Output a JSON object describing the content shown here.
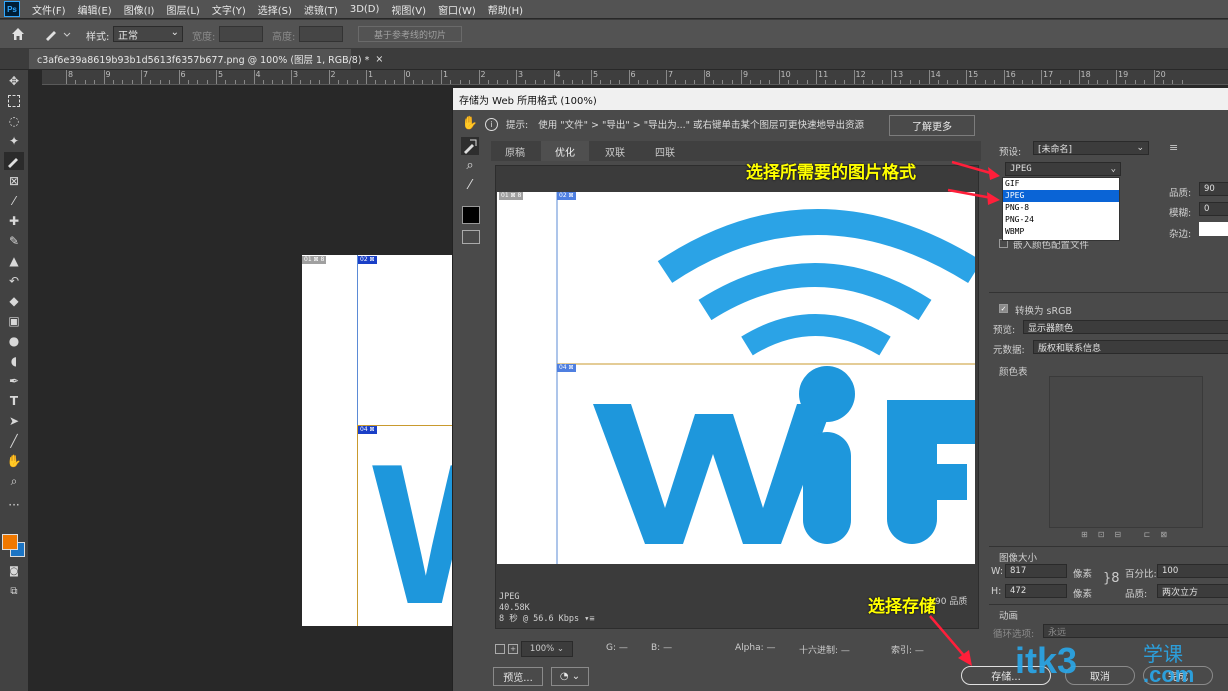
{
  "menubar": {
    "logo": "Ps",
    "items": [
      "文件(F)",
      "编辑(E)",
      "图像(I)",
      "图层(L)",
      "文字(Y)",
      "选择(S)",
      "滤镜(T)",
      "3D(D)",
      "视图(V)",
      "窗口(W)",
      "帮助(H)"
    ]
  },
  "options": {
    "style_label": "样式:",
    "style_value": "正常",
    "width_label": "宽度:",
    "height_label": "高度:",
    "slice_button": "基于参考线的切片"
  },
  "document": {
    "tab_title": "c3af6e39a8619b93b1d5613f6357b677.png @ 100% (图层 1, RGB/8) *",
    "close": "×",
    "ruler_labels": [
      "8",
      "9",
      "7",
      "6",
      "5",
      "4",
      "3",
      "2",
      "1",
      "0",
      "1",
      "2",
      "3",
      "4",
      "5",
      "6",
      "7",
      "8",
      "9",
      "10",
      "11",
      "12",
      "13",
      "14",
      "15",
      "16",
      "17",
      "18",
      "19",
      "20"
    ],
    "slice_tags": [
      "01 ⊠ 8",
      "02 ⊠",
      "04 ⊠"
    ],
    "canvas_letter": "W"
  },
  "dialog": {
    "title": "存储为 Web 所用格式 (100%)",
    "hint_label": "提示:",
    "hint_text": "使用 \"文件\" > \"导出\" > \"导出为...\" 或右键单击某个图层可更快速地导出资源",
    "learn_more": "了解更多",
    "tabs": [
      "原稿",
      "优化",
      "双联",
      "四联"
    ],
    "active_tab": 1,
    "preview_tags": [
      "01 ⊠ 8",
      "02 ⊠",
      "04 ⊠"
    ],
    "preview_text": "WiF",
    "status_format": "JPEG",
    "status_size": "40.58K",
    "status_time": "8 秒 @ 56.6 Kbps",
    "status_menu": "▾≡",
    "status_quality": "90 品质",
    "zoom": "100%",
    "bottom_labels": {
      "g": "G: —",
      "b": "B: —",
      "alpha": "Alpha: —",
      "hex": "十六进制: —",
      "index": "索引: —"
    },
    "buttons": {
      "preview": "预览...",
      "save": "存储...",
      "cancel": "取消",
      "done": "完成"
    }
  },
  "panel": {
    "preset_label": "预设:",
    "preset_value": "[未命名]",
    "format_value": "JPEG",
    "format_options": [
      "GIF",
      "JPEG",
      "PNG-8",
      "PNG-24",
      "WBMP"
    ],
    "format_selected": 1,
    "quality_label": "品质:",
    "quality_value": "90",
    "blur_label": "模糊:",
    "blur_value": "0",
    "matte_label": "杂边:",
    "embed_profile": "嵌入颜色配置文件",
    "convert_srgb": "转换为 sRGB",
    "preview_label": "预览:",
    "preview_value": "显示器颜色",
    "metadata_label": "元数据:",
    "metadata_value": "版权和联系信息",
    "color_table": "颜色表",
    "image_size": "图像大小",
    "w_label": "W:",
    "w_value": "817",
    "h_label": "H:",
    "h_value": "472",
    "pixels": "像素",
    "percent_label": "百分比:",
    "percent_value": "100",
    "quality2_label": "品质:",
    "quality2_value": "两次立方",
    "animation": "动画",
    "loop_label": "循环选项:",
    "loop_value": "永远"
  },
  "annotations": {
    "format_tip": "选择所需要的图片格式",
    "save_tip": "选择存储"
  },
  "watermark": {
    "brand": "itk3",
    "tld": ".com",
    "cn": "学课"
  },
  "colors": {
    "wifi_blue": "#2ba3e6",
    "foreground": "#f07800",
    "background": "#1b74c4",
    "annotation": "#ffff00",
    "arrow": "#ff1f3a"
  }
}
